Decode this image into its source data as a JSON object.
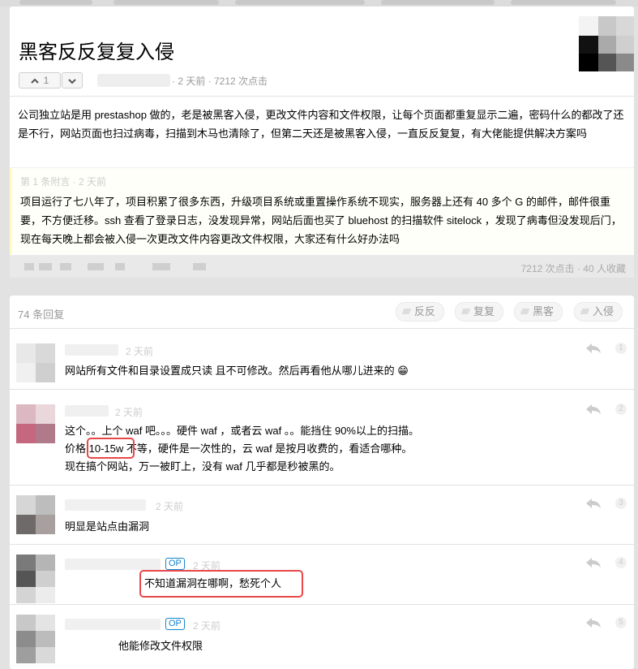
{
  "topic": {
    "title": "黑客反反复复入侵",
    "vote_up_count": "1",
    "meta": "· 2 天前 · 7212 次点击",
    "content": "公司独立站是用 prestashop 做的，老是被黑客入侵，更改文件内容和文件权限，让每个页面都重复显示二遍，密码什么的都改了还是不行，网站页面也扫过病毒，扫描到木马也清除了，但第二天还是被黑客入侵，一直反反复复，有大佬能提供解决方案吗",
    "appendix": {
      "header": "第 1 条附言 · 2 天前",
      "body": "项目运行了七八年了，项目积累了很多东西，升级项目系统或重置操作系统不现实，服务器上还有 40 多个 G 的邮件，邮件很重要，不方便迁移。ssh 查看了登录日志，没发现异常，网站后面也买了 bluehost 的扫描软件 sitelock ，发现了病毒但没发现后门，现在每天晚上都会被入侵一次更改文件内容更改文件权限，大家还有什么好办法吗"
    },
    "stats": "7212 次点击 · 40 人收藏"
  },
  "replies_header": {
    "count": "74 条回复",
    "tags": [
      "反反",
      "复复",
      "黑客",
      "入侵"
    ]
  },
  "replies": [
    {
      "time": "2 天前",
      "op": "",
      "lines": [
        "网站所有文件和目录设置成只读 且不可修改。然后再看他从哪儿进来的 😁"
      ],
      "num": "1"
    },
    {
      "time": "2 天前",
      "op": "",
      "lines": [
        "这个。。上个 waf 吧。。。硬件 waf ，或者云 waf 。。能挡住 90%以上的扫描。",
        "价格 10-15w 不等，硬件是一次性的，云 waf 是按月收费的，看适合哪种。",
        "现在搞个网站，万一被盯上，没有 waf 几乎都是秒被黑的。"
      ],
      "num": "2"
    },
    {
      "time": "2 天前",
      "op": "",
      "lines": [
        "明显是站点由漏洞"
      ],
      "num": "3"
    },
    {
      "time": "2 天前",
      "op": "OP",
      "lines": [
        "不知道漏洞在哪啊，愁死个人"
      ],
      "num": "4"
    },
    {
      "time": "2 天前",
      "op": "OP",
      "lines": [
        "他能修改文件权限"
      ],
      "num": "5"
    }
  ],
  "colors": {
    "highlight": "#e94747",
    "op_badge": "#1484cd",
    "appendix_border": "#fffbc1"
  },
  "icons": [
    "chevron-up-icon",
    "chevron-down-icon",
    "tag-icon",
    "reply-arrow-icon"
  ]
}
